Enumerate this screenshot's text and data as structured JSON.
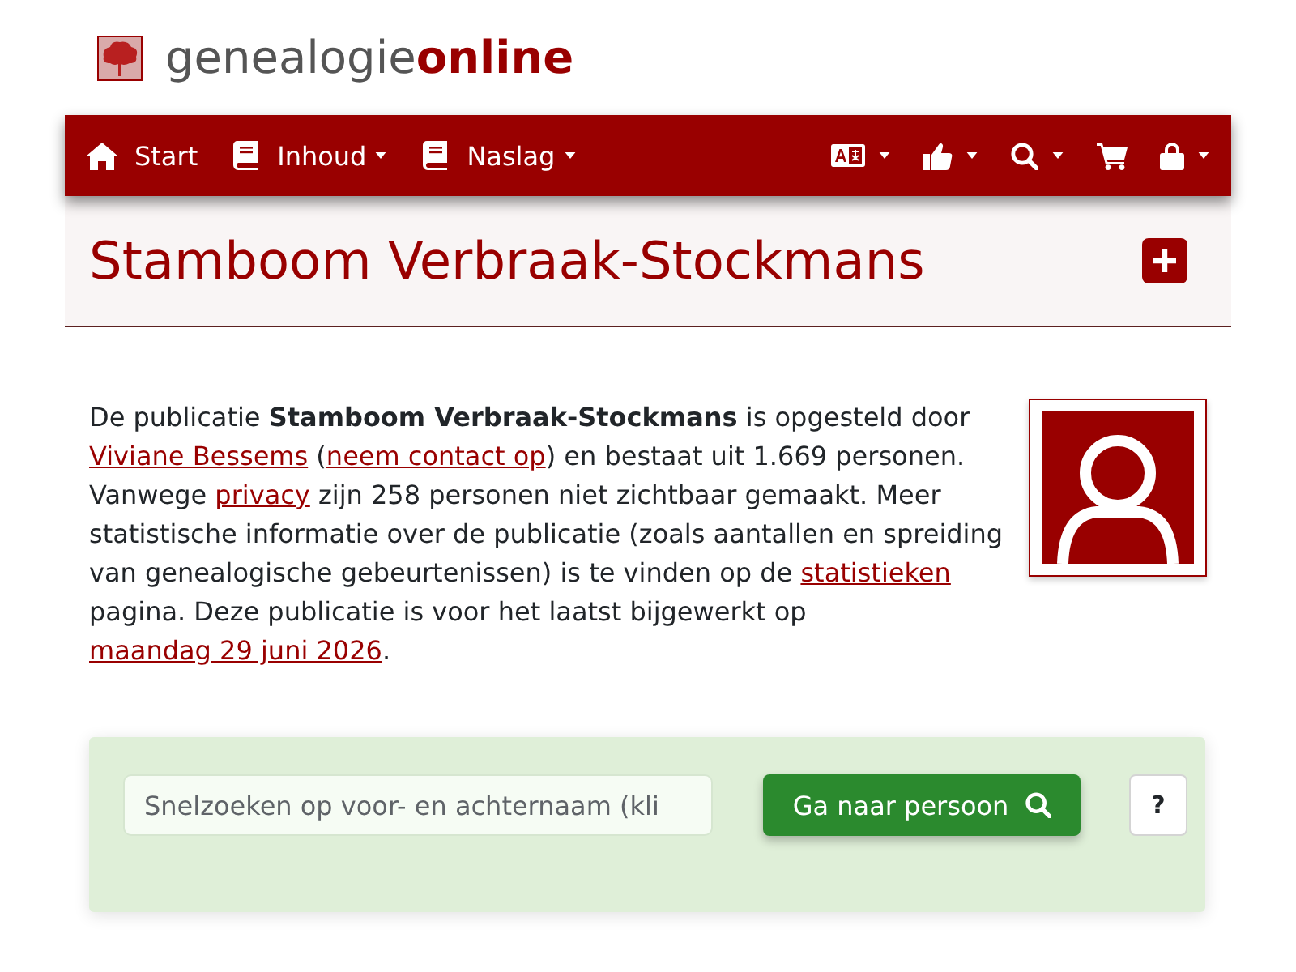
{
  "logo": {
    "text": "genealogie**online**"
  },
  "nav": {
    "items": [
      {
        "label": "Start",
        "dropdown": false
      },
      {
        "label": "Inhoud",
        "dropdown": true
      },
      {
        "label": "Naslag",
        "dropdown": true
      }
    ],
    "tools": [
      {
        "dropdown": true
      },
      {
        "dropdown": true
      },
      {
        "dropdown": true
      },
      {
        "dropdown": false
      },
      {
        "dropdown": true
      }
    ]
  },
  "header": {
    "title": "Stamboom Verbraak-Stockmans"
  },
  "intro": [
    {
      "kind": "text",
      "text": "De publicatie **Stamboom Verbraak-Stockmans** is opgesteld door "
    },
    {
      "kind": "link",
      "text": "Viviane Bessems"
    },
    {
      "kind": "text",
      "text": " ("
    },
    {
      "kind": "link",
      "text": "neem contact op"
    },
    {
      "kind": "text",
      "text": ") en bestaat uit 1.669 personen. Vanwege "
    },
    {
      "kind": "link",
      "text": "privacy"
    },
    {
      "kind": "text",
      "text": " zijn 258 personen niet zichtbaar gemaakt. Meer statistische informatie over de publicatie (zoals aantallen en spreiding van genealogische gebeurtenissen) is te vinden op de "
    },
    {
      "kind": "link",
      "text": "statistieken"
    },
    {
      "kind": "text",
      "text": " pagina. Deze publicatie is voor het laatst bijgewerkt op "
    },
    {
      "kind": "link",
      "text": "maandag 29 juni 2026"
    },
    {
      "kind": "text",
      "text": "."
    }
  ],
  "search": {
    "placeholder": "Snelzoeken op voor- en achternaam (kli",
    "button": "Ga naar persoon",
    "help": "?"
  }
}
